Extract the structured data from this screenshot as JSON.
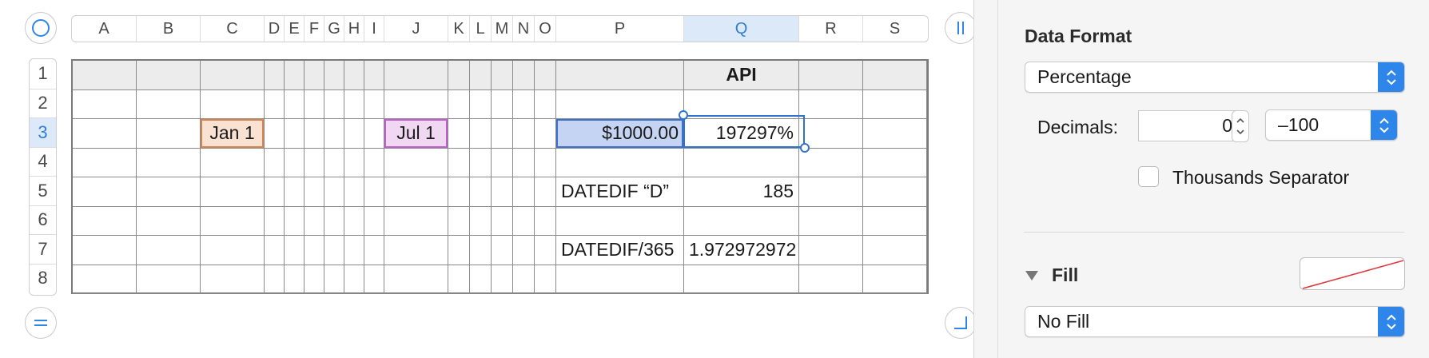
{
  "spreadsheet": {
    "columns": [
      {
        "label": "A",
        "w": 80
      },
      {
        "label": "B",
        "w": 80
      },
      {
        "label": "C",
        "w": 80
      },
      {
        "label": "D",
        "w": 25
      },
      {
        "label": "E",
        "w": 25
      },
      {
        "label": "F",
        "w": 25
      },
      {
        "label": "G",
        "w": 25
      },
      {
        "label": "H",
        "w": 25
      },
      {
        "label": "I",
        "w": 25
      },
      {
        "label": "J",
        "w": 80
      },
      {
        "label": "K",
        "w": 27
      },
      {
        "label": "L",
        "w": 27
      },
      {
        "label": "M",
        "w": 27
      },
      {
        "label": "N",
        "w": 27
      },
      {
        "label": "O",
        "w": 27
      },
      {
        "label": "P",
        "w": 160
      },
      {
        "label": "Q",
        "w": 144,
        "selected": true
      },
      {
        "label": "R",
        "w": 80
      },
      {
        "label": "S",
        "w": 80
      }
    ],
    "rows": [
      {
        "label": "1"
      },
      {
        "label": "2"
      },
      {
        "label": "3",
        "selected": true
      },
      {
        "label": "4"
      },
      {
        "label": "5"
      },
      {
        "label": "6"
      },
      {
        "label": "7"
      },
      {
        "label": "8"
      }
    ],
    "cells": {
      "Q1": {
        "text": "API",
        "style": "bold center"
      },
      "C3": {
        "text": "Jan 1",
        "style": "center",
        "bg": "#f9e2d2",
        "border": "#d9824a"
      },
      "J3": {
        "text": "Jul 1",
        "style": "center",
        "bg": "#f0d8f3",
        "border": "#c15dcf"
      },
      "P3": {
        "text": "$1000.00",
        "style": "right",
        "bg": "#c5d4f3",
        "border": "#3b6fd1"
      },
      "Q3": {
        "text": "197297%",
        "style": "right"
      },
      "P5": {
        "text": "DATEDIF “D”",
        "style": "left"
      },
      "Q5": {
        "text": "185",
        "style": "right"
      },
      "P7": {
        "text": "DATEDIF/365",
        "style": "left"
      },
      "Q7": {
        "text": "1.972972972",
        "style": "left"
      }
    }
  },
  "panel": {
    "data_format_title": "Data Format",
    "data_format_value": "Percentage",
    "decimals_label": "Decimals:",
    "decimals_value": "0",
    "negative_value": "–100",
    "thousands_label": "Thousands Separator",
    "fill_label": "Fill",
    "fill_value": "No Fill"
  },
  "colors": {
    "accent": "#2f86ea",
    "selection": "#2e73d1",
    "header_fill": "#ececec"
  }
}
